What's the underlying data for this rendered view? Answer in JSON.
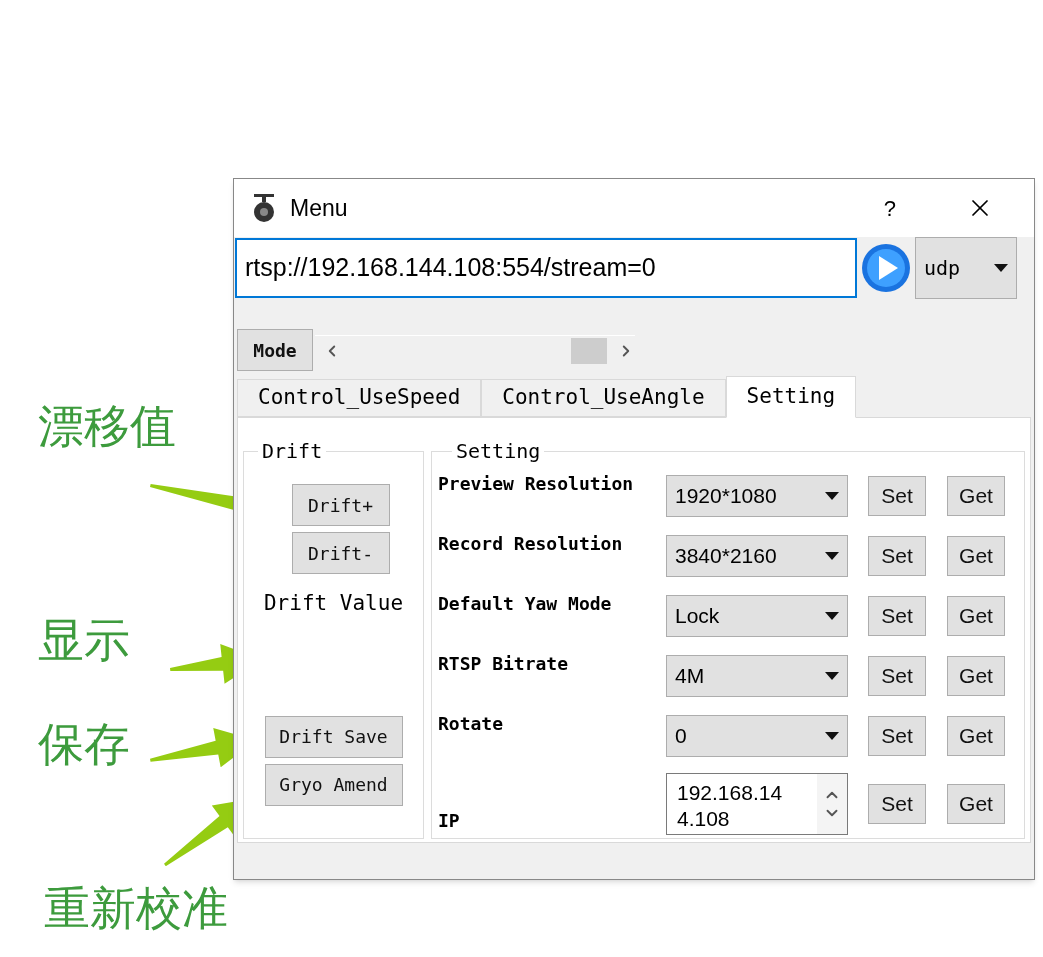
{
  "annotations": [
    {
      "text": "漂移值"
    },
    {
      "text": "显示"
    },
    {
      "text": "保存"
    },
    {
      "text": "重新校准"
    }
  ],
  "window": {
    "title": "Menu",
    "help": "?"
  },
  "url_bar": {
    "value": "rtsp://192.168.144.108:554/stream=0",
    "protocol": "udp"
  },
  "mode_button": "Mode",
  "tabs": [
    {
      "label": "Control_UseSpeed",
      "selected": false
    },
    {
      "label": "Control_UseAngle",
      "selected": false
    },
    {
      "label": "Setting",
      "selected": true
    }
  ],
  "drift_group": {
    "title": "Drift",
    "buttons": [
      "Drift+",
      "Drift-"
    ],
    "value_label": "Drift Value",
    "bottom_buttons": [
      "Drift Save",
      "Gryo Amend"
    ]
  },
  "setting_group": {
    "title": "Setting",
    "rows": [
      {
        "kind": "select",
        "label": "Preview Resolution",
        "value": "1920*1080",
        "set": "Set",
        "get": "Get"
      },
      {
        "kind": "select",
        "label": "Record Resolution",
        "value": "3840*2160",
        "set": "Set",
        "get": "Get"
      },
      {
        "kind": "select",
        "label": "Default Yaw Mode",
        "value": "Lock",
        "set": "Set",
        "get": "Get"
      },
      {
        "kind": "select",
        "label": "RTSP Bitrate",
        "value": "4M",
        "set": "Set",
        "get": "Get"
      },
      {
        "kind": "select",
        "label": "Rotate",
        "value": "0",
        "set": "Set",
        "get": "Get"
      },
      {
        "kind": "spin",
        "label": "IP",
        "value": "192.168.144.108",
        "set": "Set",
        "get": "Get"
      }
    ]
  }
}
